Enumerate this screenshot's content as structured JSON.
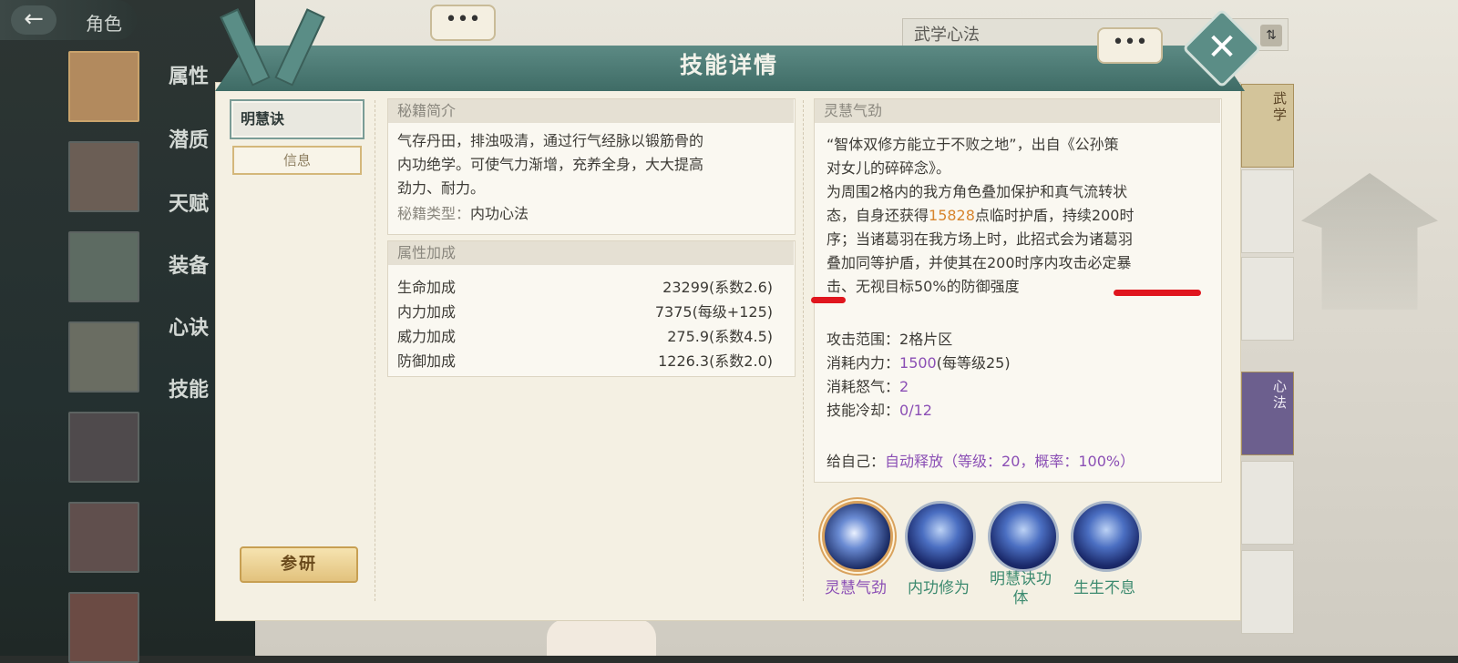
{
  "topbar": {
    "back_label": "角色",
    "dots": "•••"
  },
  "side_tabs": [
    "属性",
    "潜质",
    "天赋",
    "装备",
    "心诀",
    "技能"
  ],
  "wuxue_bar": {
    "title": "武学心法"
  },
  "right_cards": [
    "武学",
    "心法"
  ],
  "dialog": {
    "title": "技能详情",
    "tab_main": "明慧诀",
    "tab_sub": "信息",
    "research_button": "参研"
  },
  "intro": {
    "header": "秘籍简介",
    "lines": [
      "气存丹田，排浊吸清，通过行气经脉以锻筋骨的",
      "内功绝学。可使气力渐增，充养全身，大大提高",
      "劲力、耐力。"
    ],
    "type_label": "秘籍类型：",
    "type_value": "内功心法"
  },
  "attributes": {
    "header": "属性加成",
    "rows": [
      {
        "label": "生命加成",
        "value": "23299(系数2.6)"
      },
      {
        "label": "内力加成",
        "value": "7375(每级+125)"
      },
      {
        "label": "威力加成",
        "value": "275.9(系数4.5)"
      },
      {
        "label": "防御加成",
        "value": "1226.3(系数2.0)"
      }
    ]
  },
  "skill_detail": {
    "header": "灵慧气劲",
    "quote_lines": [
      "“智体双修方能立于不败之地”，出自《公孙策",
      "对女儿的碎碎念》。"
    ],
    "desc_l1": "为周围2格内的我方角色叠加保护和真气流转状",
    "desc_l2a": "态，自身还获得",
    "desc_l2_num": "15828",
    "desc_l2b": "点临时护盾，持续200时",
    "desc_l3": "序；当诸葛羽在我方场上时，此招式会为诸葛羽",
    "desc_l4": "叠加同等护盾，并使其在200时序内攻击必定暴",
    "desc_l5": "击、无视目标50%的防御强度",
    "range_label": "攻击范围：",
    "range_value": "2格片区",
    "mp_label": "消耗内力：",
    "mp_value": "1500",
    "mp_note": "(每等级25)",
    "rage_label": "消耗怒气：",
    "rage_value": "2",
    "cd_label": "技能冷却：",
    "cd_value": "0/12",
    "self_label": "给自己：",
    "self_value": "自动释放（等级：20，概率：100%）"
  },
  "skills": [
    {
      "name": "灵慧气劲",
      "active": true
    },
    {
      "name": "内功修为",
      "active": false
    },
    {
      "name": "明慧诀功体",
      "active": false
    },
    {
      "name": "生生不息",
      "active": false
    }
  ],
  "colors": {
    "accent": "#5b8d86",
    "purple": "#8b4fb5",
    "orange": "#d7852e",
    "mark_red": "#e0161e"
  }
}
